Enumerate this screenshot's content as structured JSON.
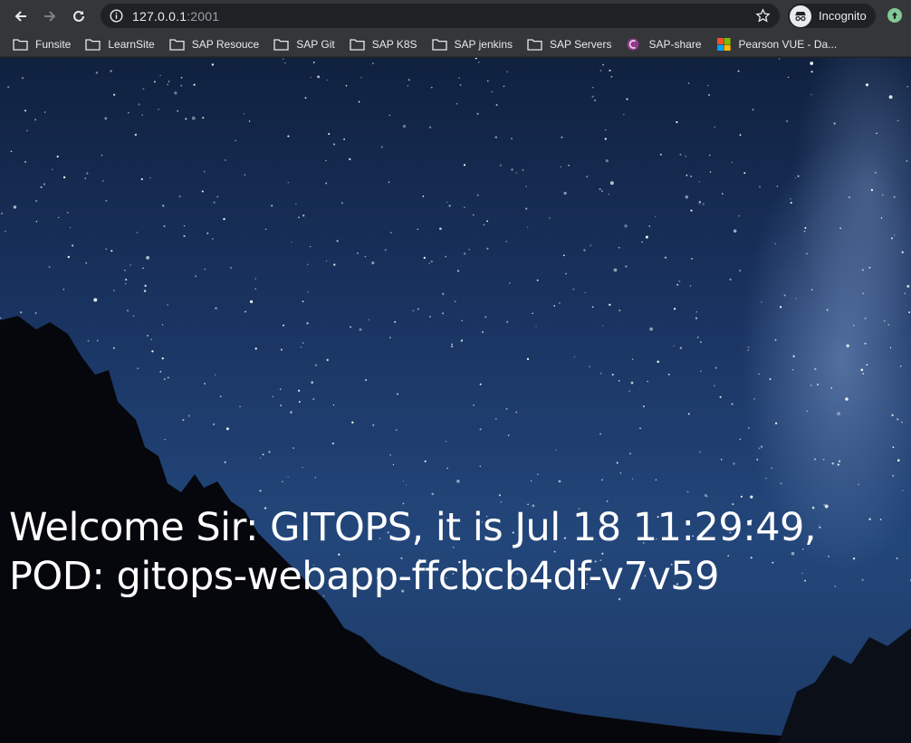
{
  "browser": {
    "url_host": "127.0.0.1",
    "url_port": ":2001",
    "profile_label": "Incognito"
  },
  "bookmarks": [
    {
      "label": "Funsite",
      "icon": "folder-icon"
    },
    {
      "label": "LearnSite",
      "icon": "folder-icon"
    },
    {
      "label": "SAP Resouce",
      "icon": "folder-icon"
    },
    {
      "label": "SAP Git",
      "icon": "folder-icon"
    },
    {
      "label": "SAP K8S",
      "icon": "folder-icon"
    },
    {
      "label": "SAP jenkins",
      "icon": "folder-icon"
    },
    {
      "label": "SAP Servers",
      "icon": "folder-icon"
    },
    {
      "label": "SAP-share",
      "icon": "sap-share-icon"
    },
    {
      "label": "Pearson VUE - Da...",
      "icon": "microsoft-icon"
    }
  ],
  "page": {
    "line1": "Welcome Sir: GITOPS, it is Jul 18 11:29:49,",
    "line2": "POD: gitops-webapp-ffcbcb4df-v7v59"
  },
  "colors": {
    "toolbar": "#35363a",
    "omnibox": "#202124",
    "sky_top": "#10213f",
    "sky_bottom": "#23467a",
    "text": "#ffffff"
  }
}
